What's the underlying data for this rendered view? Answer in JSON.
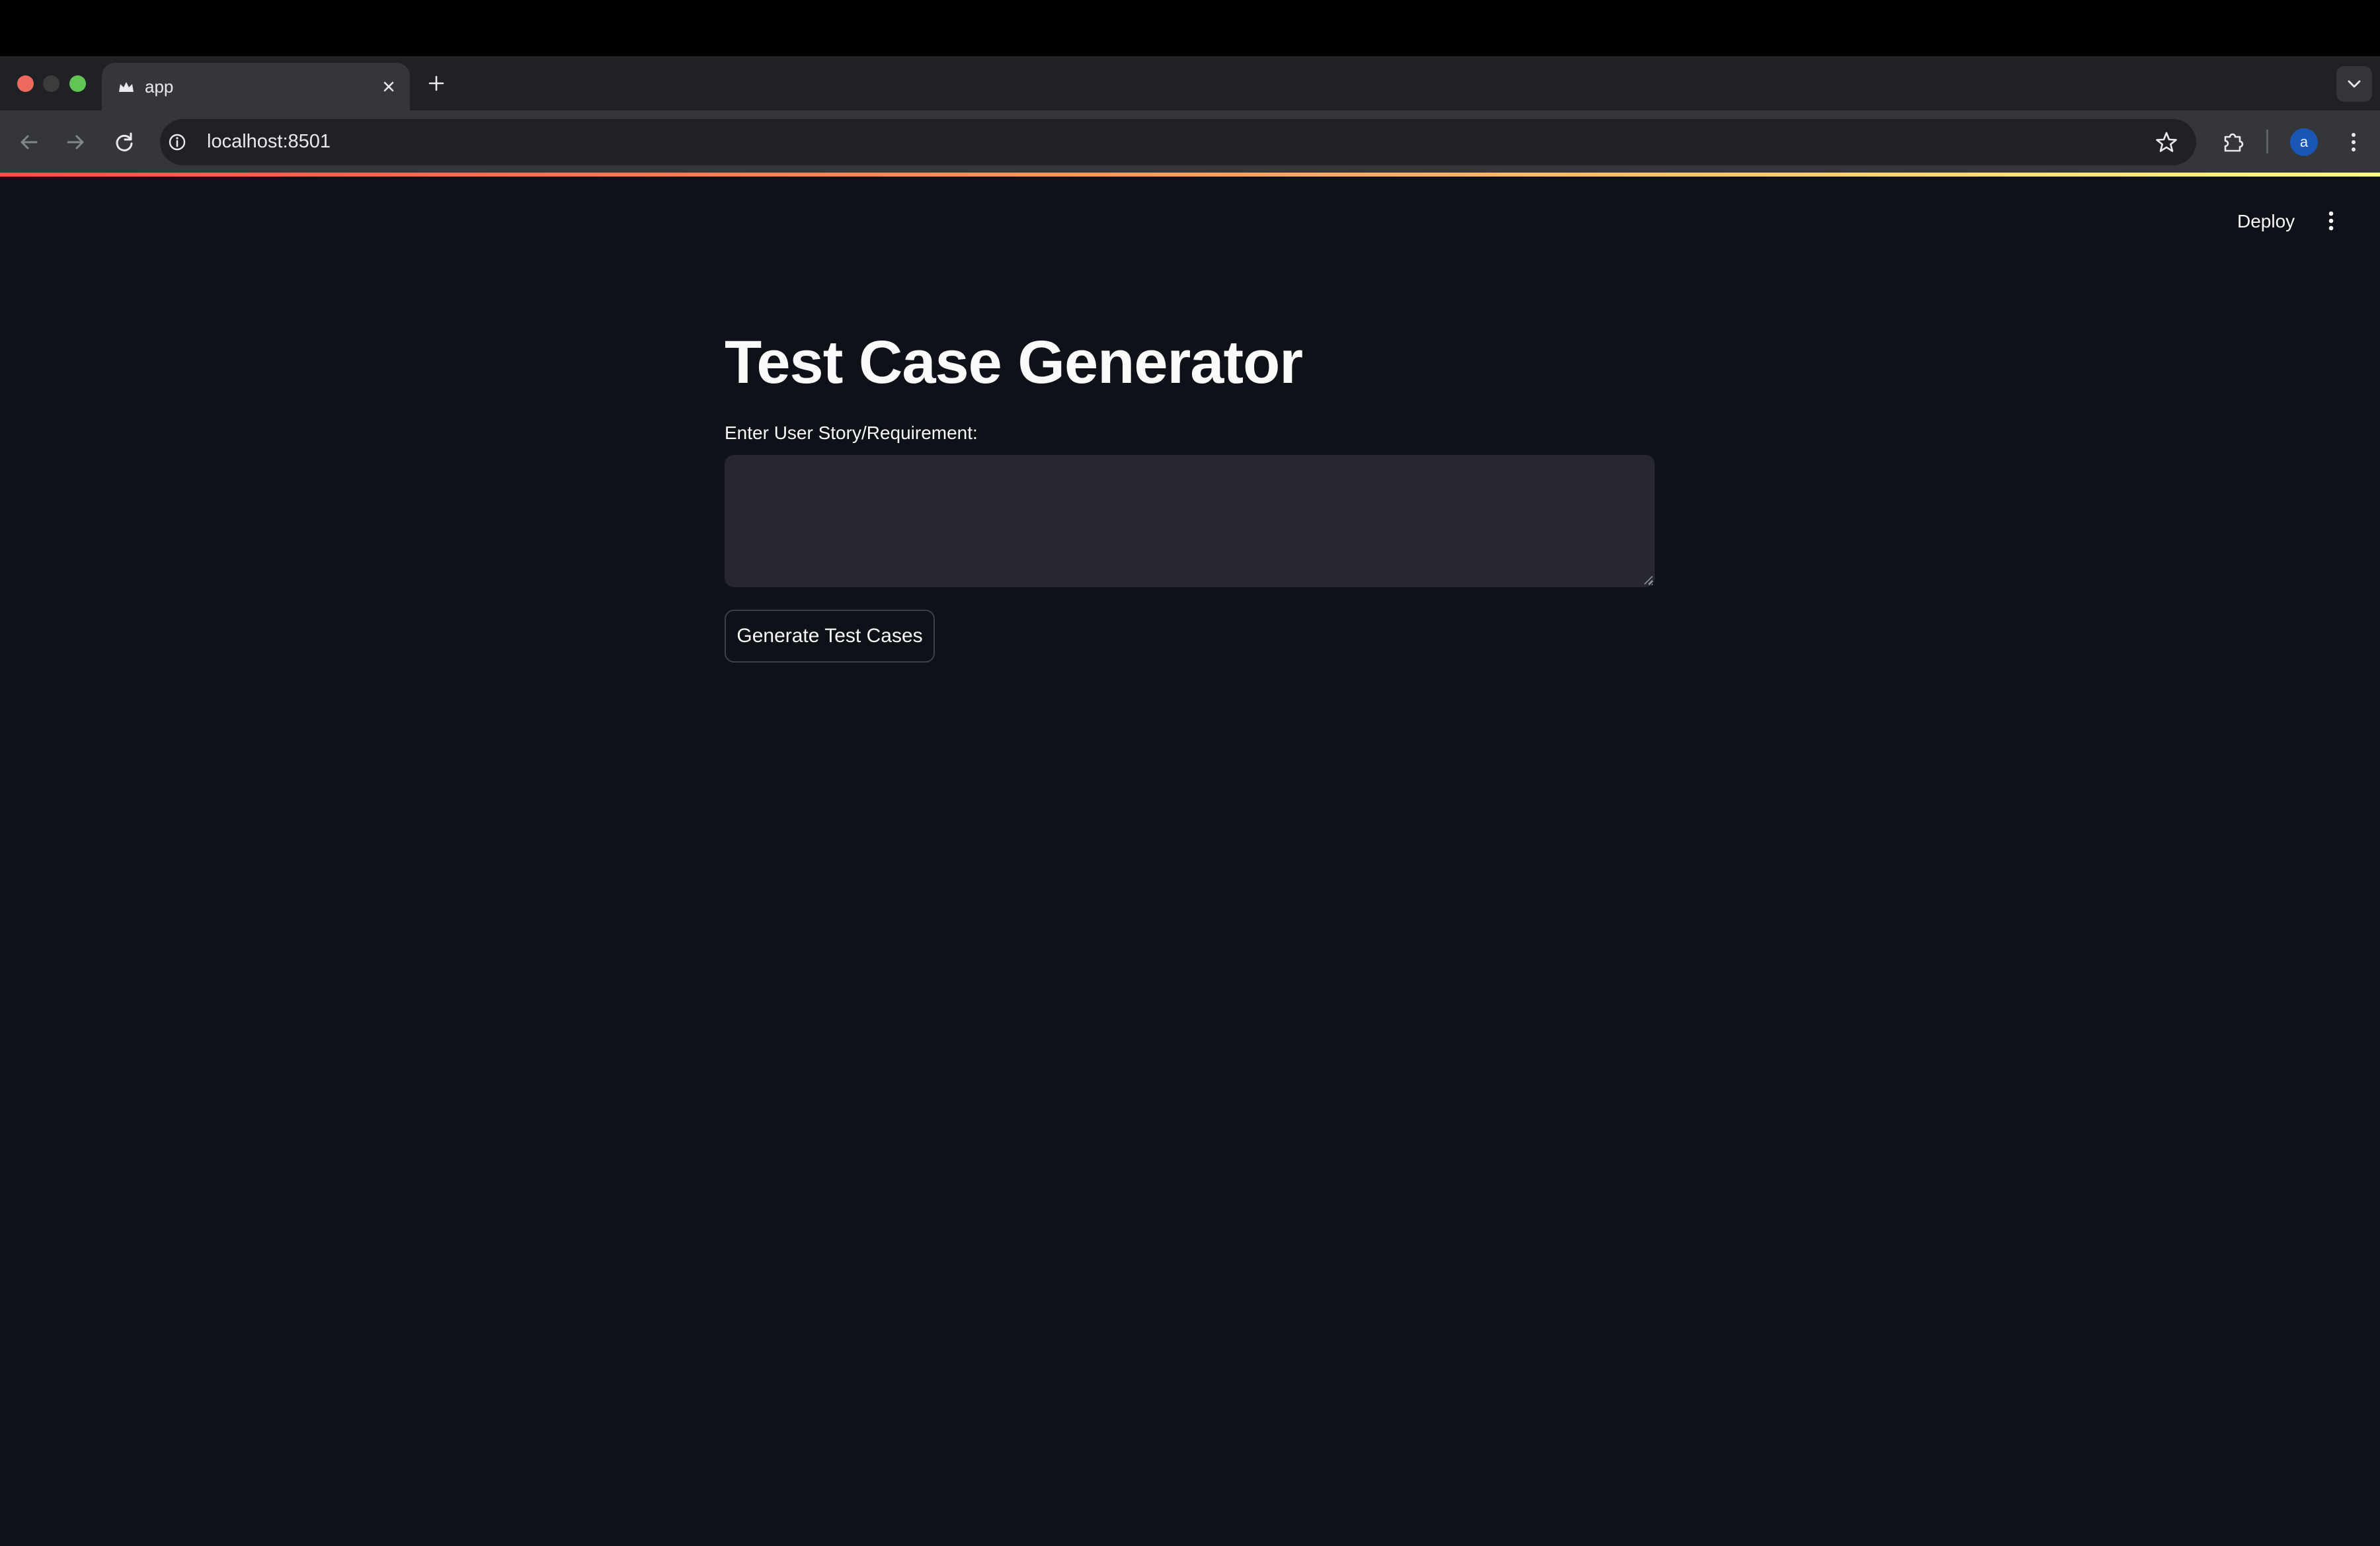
{
  "browser": {
    "tab": {
      "title": "app"
    },
    "address_bar": {
      "url": "localhost:8501"
    },
    "profile_initial": "a"
  },
  "app": {
    "header": {
      "deploy_label": "Deploy"
    },
    "title": "Test Case Generator",
    "story_field": {
      "label": "Enter User Story/Requirement:",
      "value": ""
    },
    "generate_button_label": "Generate Test Cases"
  },
  "colors": {
    "background": "#0e1117",
    "input_background": "#262730",
    "text": "#fafafa",
    "accent_gradient": [
      "#ff4b4b",
      "#fffd80"
    ]
  },
  "icons": [
    "crown-favicon-icon",
    "close-icon",
    "plus-icon",
    "chevron-down-icon",
    "back-arrow-icon",
    "forward-arrow-icon",
    "reload-icon",
    "info-icon",
    "star-icon",
    "puzzle-icon",
    "kebab-menu-icon"
  ]
}
